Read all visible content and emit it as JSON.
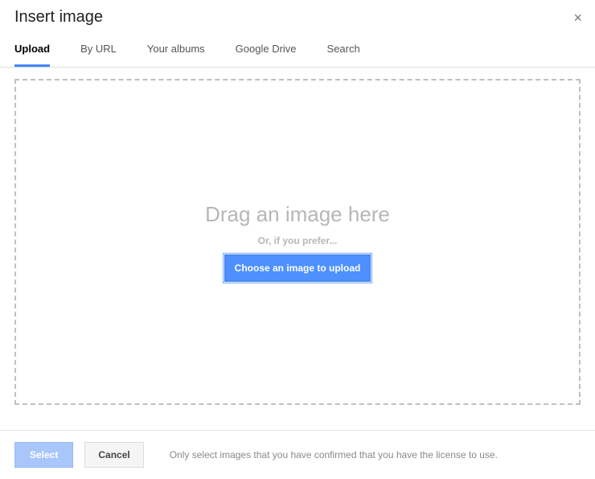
{
  "header": {
    "title": "Insert image",
    "close_glyph": "×"
  },
  "tabs": {
    "items": [
      {
        "label": "Upload",
        "active": true
      },
      {
        "label": "By URL",
        "active": false
      },
      {
        "label": "Your albums",
        "active": false
      },
      {
        "label": "Google Drive",
        "active": false
      },
      {
        "label": "Search",
        "active": false
      }
    ]
  },
  "dropzone": {
    "drag_text": "Drag an image here",
    "or_text": "Or, if you prefer...",
    "choose_label": "Choose an image to upload"
  },
  "footer": {
    "select_label": "Select",
    "cancel_label": "Cancel",
    "note": "Only select images that you have confirmed that you have the license to use."
  }
}
